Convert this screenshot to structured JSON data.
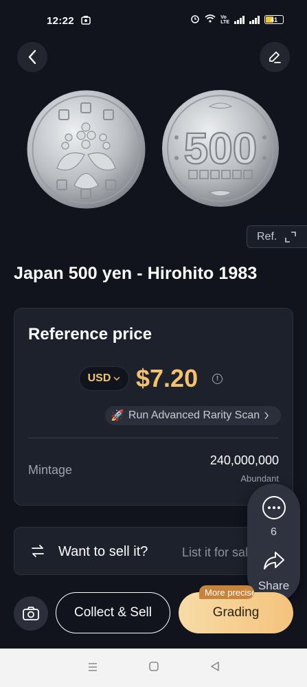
{
  "status_bar": {
    "time": "12:22",
    "battery": "41"
  },
  "header": {
    "back_icon": "chevron-left-icon",
    "edit_icon": "edit-pencil-icon"
  },
  "reference_chip": {
    "label": "Ref."
  },
  "coin": {
    "title": "Japan 500 yen - Hirohito 1983",
    "back_denomination": "500"
  },
  "price_card": {
    "heading": "Reference price",
    "currency": "USD",
    "price": "$7.20",
    "scan_label": "Run Advanced Rarity Scan",
    "mintage_label": "Mintage",
    "mintage_value": "240,000,000",
    "mintage_rarity": "Abundant"
  },
  "sell_card": {
    "question": "Want to sell it?",
    "cta": "List it for sale"
  },
  "float_panel": {
    "comment_count": "6",
    "share_label": "Share"
  },
  "bottom_bar": {
    "collect_label": "Collect & Sell",
    "grading_label": "Grading",
    "badge": "More precise"
  },
  "colors": {
    "background": "#11141d",
    "card": "#1c212c",
    "price_accent": "#f4c26c",
    "grading_button": "#f6cf8f"
  }
}
